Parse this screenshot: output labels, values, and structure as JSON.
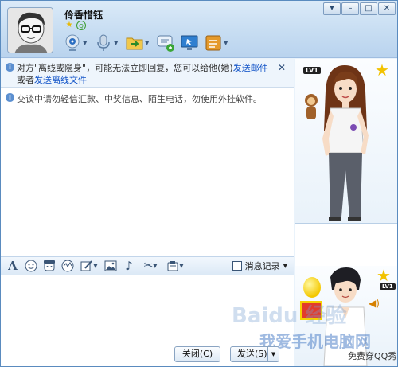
{
  "header": {
    "contact_name": "伶香惜钰",
    "window_buttons": [
      "▾",
      "–",
      "□",
      "✕"
    ]
  },
  "toolbar": {
    "icons": [
      "video-call-icon",
      "voice-call-icon",
      "send-file-icon",
      "multi-chat-icon",
      "remote-assist-icon",
      "app-menu-icon"
    ]
  },
  "notice": {
    "text_1": "对方\"离线或隐身\"，可能无法立即回复，您可以给他(她)",
    "link_email": "发送邮件",
    "text_2": "或者",
    "link_file": "发送离线文件",
    "close": "✕"
  },
  "warning": {
    "text": "交谈中请勿轻信汇款、中奖信息、陌生电话，勿使用外挂软件。"
  },
  "format_bar": {
    "icons": [
      "font-icon",
      "emoji-icon",
      "magic-face-icon",
      "wobble-icon",
      "handwriting-icon",
      "image-icon",
      "music-icon",
      "screenshot-icon",
      "more-icon"
    ],
    "history_label": "消息记录"
  },
  "buttons": {
    "close_label": "关闭(C)",
    "send_label": "发送(S)"
  },
  "show": {
    "top_level": "LV1",
    "bottom_level": "LV1",
    "dress_up": "免费穿QQ秀"
  },
  "watermark": {
    "line1": "Baidu 经验",
    "line2": "我爱手机电脑网"
  },
  "colors": {
    "link": "#1254c8",
    "header_bg": "#c7ddf2",
    "accent": "#5a8bbf"
  }
}
